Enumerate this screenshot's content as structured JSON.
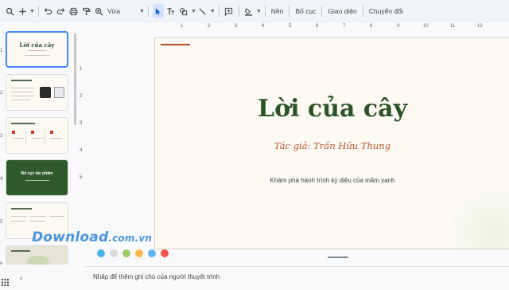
{
  "toolbar": {
    "zoom_value": "Vừa",
    "background_label": "Nền",
    "layout_label": "Bố cục",
    "theme_label": "Giao diện",
    "transition_label": "Chuyển đổi"
  },
  "ruler": {
    "h_ticks": [
      "1",
      "2",
      "3",
      "4",
      "5",
      "6",
      "7",
      "8",
      "9",
      "10",
      "11",
      "12"
    ],
    "v_ticks": [
      "1",
      "2",
      "3",
      "4",
      "5"
    ]
  },
  "filmstrip": {
    "numbers": [
      "1",
      "2",
      "3",
      "4",
      "5",
      "6"
    ],
    "slide1_title": "Lời của cây",
    "slide4_title": "Bố cục tác phẩm"
  },
  "slide": {
    "title": "Lời của cây",
    "author": "Tác giả: Trần Hữu Thung",
    "subtitle": "Khám phá hành trình kỳ diệu của mầm xanh"
  },
  "notes": {
    "placeholder": "Nhấp để thêm ghi chú của người thuyết trình"
  },
  "watermark": {
    "text": "Download",
    "domain": ".com.vn"
  },
  "watermark_colors": [
    "#4fb5e6",
    "#d9d9d9",
    "#9ccc65",
    "#ffb74d",
    "#64b5f6",
    "#ef5350"
  ]
}
